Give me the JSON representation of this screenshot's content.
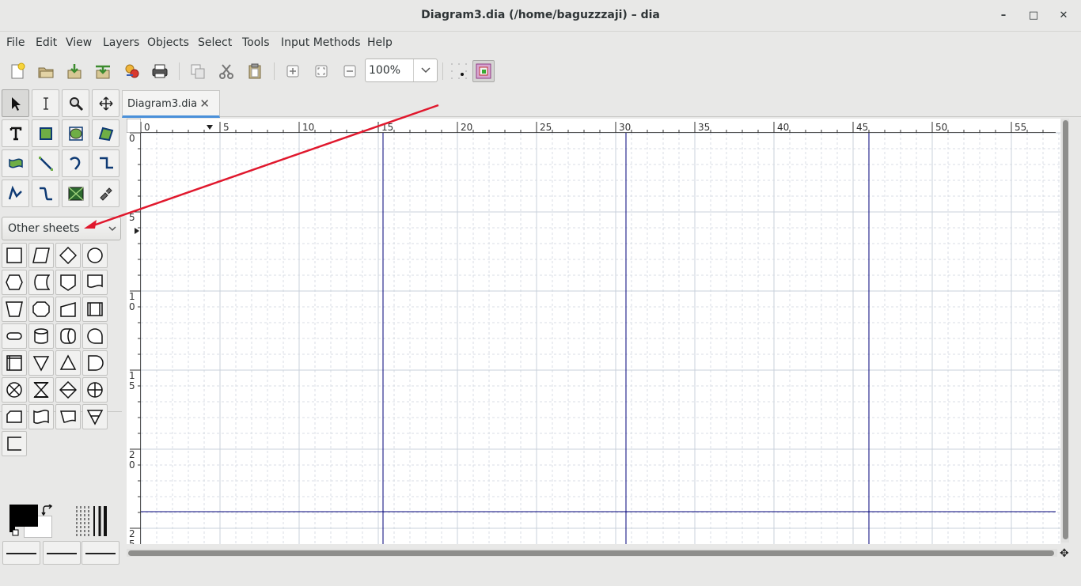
{
  "window": {
    "title": "Diagram3.dia (/home/baguzzzaji) – dia",
    "minimize": "–",
    "maximize": "□",
    "close": "✕"
  },
  "menubar": [
    "File",
    "Edit",
    "View",
    "Layers",
    "Objects",
    "Select",
    "Tools",
    "Input Methods",
    "Help"
  ],
  "toolbar": {
    "zoom_value": "100%"
  },
  "toolbox": {
    "sheet_selector": "Other sheets"
  },
  "tabs": [
    {
      "label": "Diagram3.dia",
      "close": "✕"
    }
  ],
  "ruler": {
    "h_labels": [
      "0",
      "5",
      "10",
      "15",
      "20",
      "25",
      "30",
      "35",
      "40",
      "45",
      "50",
      "55"
    ],
    "v_labels": [
      "0",
      "5",
      "1\n0",
      "1\n5",
      "2\n0",
      "2\n5"
    ]
  },
  "colors": {
    "accent": "#4a90d9",
    "guide": "#00007a",
    "annotation_arrow": "#e0182d",
    "grid": "#d8dde4"
  },
  "icons": {
    "toolbar": [
      "new-icon",
      "open-icon",
      "save-icon",
      "save-as-icon",
      "export-icon",
      "print-icon",
      "copy-icon",
      "cut-icon",
      "paste-icon",
      "zoom-in-icon",
      "zoom-fit-icon",
      "zoom-out-icon",
      "snap-grid-icon",
      "snap-object-icon"
    ],
    "tools": [
      "pointer-icon",
      "text-edit-icon",
      "magnify-icon",
      "scroll-icon",
      "text-icon",
      "box-icon",
      "ellipse-icon",
      "polygon-icon",
      "beziergon-icon",
      "line-icon",
      "arc-icon",
      "zigzag-icon",
      "polyline-icon",
      "bezier-icon",
      "image-icon",
      "outline-icon"
    ]
  }
}
